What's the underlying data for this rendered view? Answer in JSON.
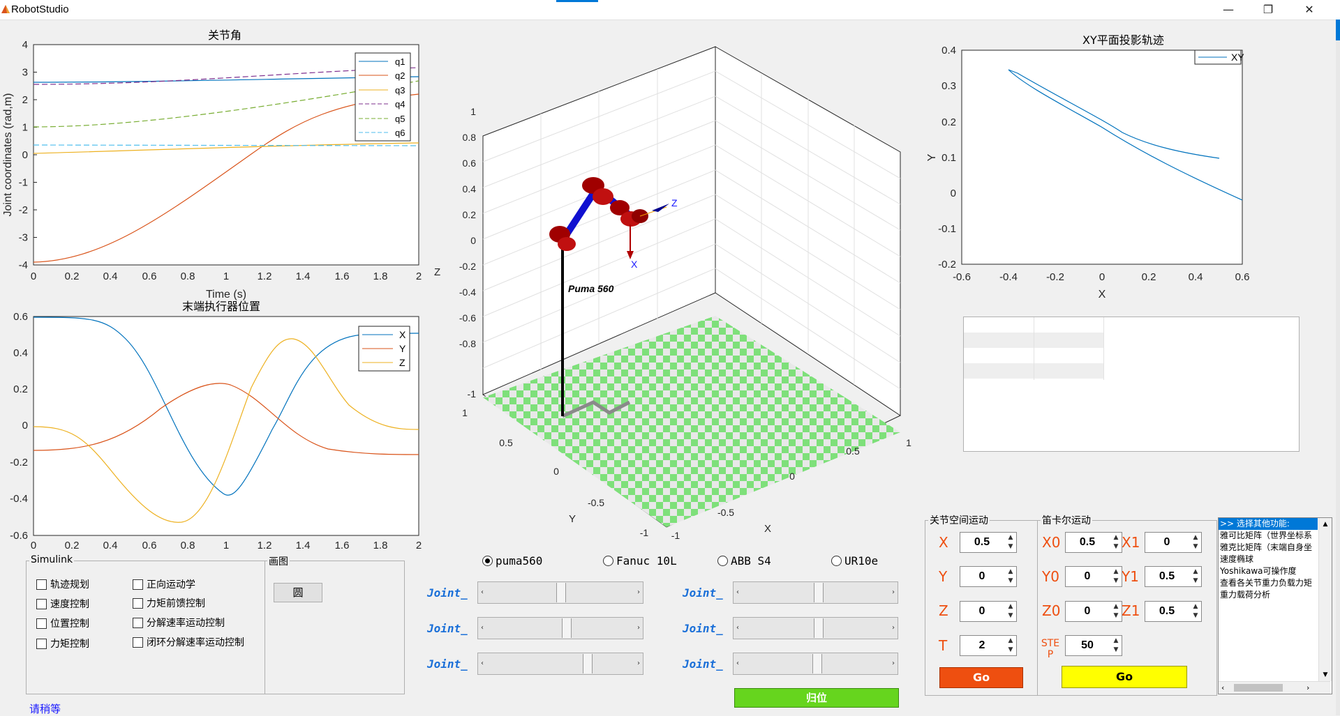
{
  "window": {
    "title": "RobotStudio",
    "minimize": "—",
    "maximize": "❐",
    "close": "✕"
  },
  "plot1": {
    "title": "关节角",
    "xlabel": "Time (s)",
    "ylabel": "Joint coordinates (rad,m)",
    "xticks": [
      "0",
      "0.2",
      "0.4",
      "0.6",
      "0.8",
      "1",
      "1.2",
      "1.4",
      "1.6",
      "1.8",
      "2"
    ],
    "yticks": [
      "4",
      "3",
      "2",
      "1",
      "0",
      "-1",
      "-2",
      "-3",
      "-4"
    ],
    "legend": [
      "q1",
      "q2",
      "q3",
      "q4",
      "q5",
      "q6"
    ]
  },
  "plot2": {
    "title": "末端执行器位置",
    "xticks": [
      "0",
      "0.2",
      "0.4",
      "0.6",
      "0.8",
      "1",
      "1.2",
      "1.4",
      "1.6",
      "1.8",
      "2"
    ],
    "yticks": [
      "0.6",
      "0.4",
      "0.2",
      "0",
      "-0.2",
      "-0.4",
      "-0.6"
    ],
    "legend": [
      "X",
      "Y",
      "Z"
    ]
  },
  "plot3d": {
    "zticks": [
      "1",
      "0.8",
      "0.6",
      "0.4",
      "0.2",
      "0",
      "-0.2",
      "-0.4",
      "-0.6",
      "-0.8",
      "-1"
    ],
    "zlabel": "Z",
    "yticks": [
      "1",
      "0.5",
      "0",
      "-0.5",
      "-1"
    ],
    "ylabel": "Y",
    "xticks": [
      "-1",
      "-0.5",
      "0",
      "0.5",
      "1"
    ],
    "xlabel": "X",
    "robot_name": "Puma 560",
    "frame_z": "Z",
    "frame_x": "X"
  },
  "plot4": {
    "title": "XY平面投影轨迹",
    "xlabel": "X",
    "ylabel": "Y",
    "xticks": [
      "-0.6",
      "-0.4",
      "-0.2",
      "0",
      "0.2",
      "0.4",
      "0.6"
    ],
    "yticks": [
      "0.4",
      "0.3",
      "0.2",
      "0.1",
      "0",
      "-0.1",
      "-0.2"
    ],
    "legend": [
      "XY"
    ]
  },
  "simulink": {
    "label": "Simulink",
    "items": [
      "轨迹规划",
      "速度控制",
      "位置控制",
      "力矩控制",
      "正向运动学",
      "力矩前馈控制",
      "分解速率运动控制",
      "闭环分解速率运动控制"
    ]
  },
  "drawing": {
    "label": "画图",
    "circle_button": "圆"
  },
  "status": "请稍等",
  "robots": {
    "options": [
      "puma560",
      "Fanuc 10L",
      "ABB S4",
      "UR10e"
    ],
    "selected": "puma560"
  },
  "joints": {
    "label": "Joint_",
    "sliders": [
      {
        "value": 0.5
      },
      {
        "value": 0.54
      },
      {
        "value": 0.69
      },
      {
        "value": 0.52
      },
      {
        "value": 0.52
      },
      {
        "value": 0.51
      }
    ]
  },
  "home_button": "归位",
  "joint_space": {
    "label": "关节空间运动",
    "fields": [
      {
        "name": "X",
        "value": "0.5"
      },
      {
        "name": "Y",
        "value": "0"
      },
      {
        "name": "Z",
        "value": "0"
      },
      {
        "name": "T",
        "value": "2"
      }
    ],
    "go": "Go"
  },
  "cartesian": {
    "label": "笛卡尔运动",
    "fields": [
      {
        "name": "X0",
        "value": "0.5"
      },
      {
        "name": "X1",
        "value": "0"
      },
      {
        "name": "Y0",
        "value": "0"
      },
      {
        "name": "Y1",
        "value": "0.5"
      },
      {
        "name": "Z0",
        "value": "0"
      },
      {
        "name": "Z1",
        "value": "0.5"
      }
    ],
    "step_label_1": "STE",
    "step_label_2": "P",
    "step_value": "50",
    "go": "Go"
  },
  "functions": {
    "items": [
      ">> 选择其他功能:",
      "雅可比矩阵（世界坐标系",
      "雅克比矩阵（末端自身坐",
      "速度椭球",
      "Yoshikawa可操作度",
      "查看各关节重力负载力矩",
      "重力载荷分析"
    ]
  },
  "colors": {
    "orange": "#ee4f10",
    "green": "#66d51e",
    "yellow": "#ffff00",
    "blue": "#1a6fd8"
  }
}
